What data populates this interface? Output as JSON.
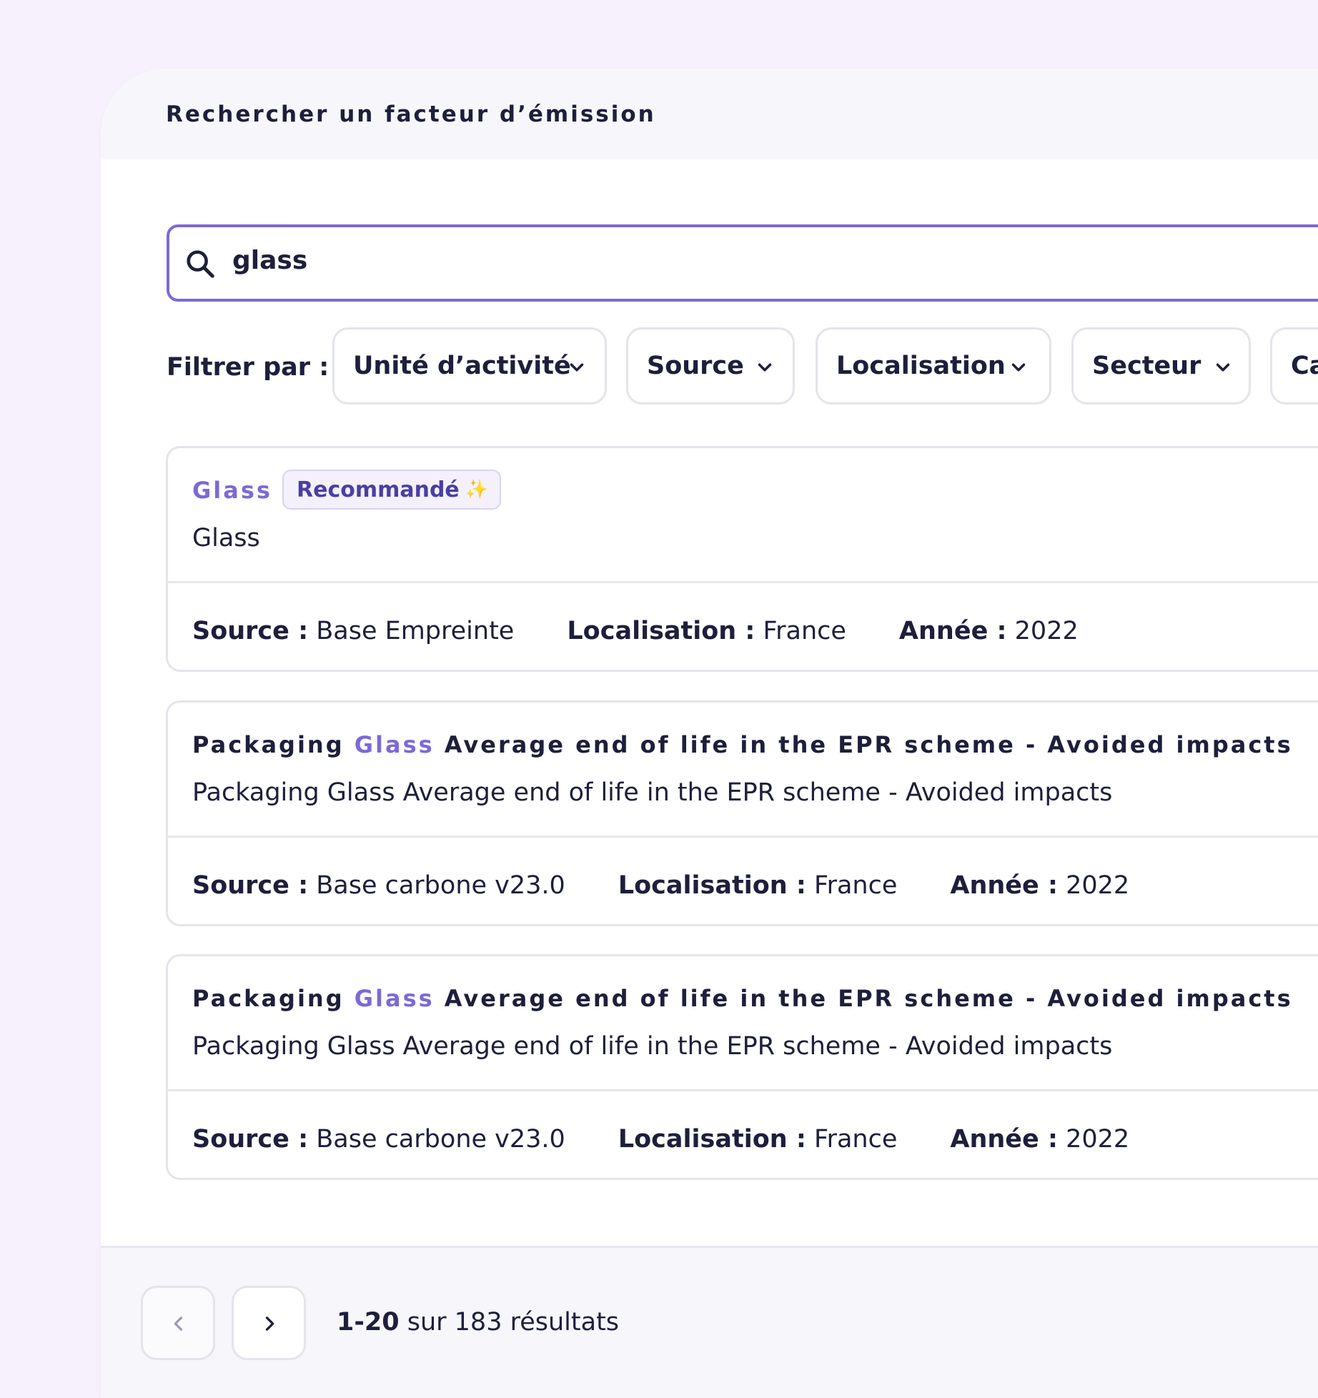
{
  "panel": {
    "title": "Rechercher un facteur d’émission"
  },
  "search": {
    "value": "glass"
  },
  "filters": {
    "label": "Filtrer par :",
    "chips": [
      "Unité d’activité",
      "Source",
      "Localisation",
      "Secteur",
      "Ca"
    ]
  },
  "results": [
    {
      "title_pre": "",
      "title_hl": "Glass",
      "title_post": "",
      "badge": "Recommandé",
      "subtitle": "Glass",
      "source_label": "Source :",
      "source": "Base Empreinte",
      "loc_label": "Localisation :",
      "loc": "France",
      "year_label": "Année :",
      "year": "2022"
    },
    {
      "title_pre": "Packaging ",
      "title_hl": "Glass",
      "title_post": " Average end of life in the EPR scheme - Avoided impacts",
      "subtitle": "Packaging Glass Average end of life in the EPR scheme - Avoided impacts",
      "source_label": "Source :",
      "source": "Base carbone v23.0",
      "loc_label": "Localisation :",
      "loc": "France",
      "year_label": "Année :",
      "year": "2022"
    },
    {
      "title_pre": "Packaging ",
      "title_hl": "Glass",
      "title_post": " Average end of life in the EPR scheme - Avoided impacts",
      "subtitle": "Packaging Glass Average end of life in the EPR scheme - Avoided impacts",
      "source_label": "Source :",
      "source": "Base carbone v23.0",
      "loc_label": "Localisation :",
      "loc": "France",
      "year_label": "Année :",
      "year": "2022"
    }
  ],
  "pagination": {
    "range": "1-20",
    "rest": "sur 183 résultats"
  },
  "colors": {
    "accent": "#7e68d6",
    "text": "#1d1f3b",
    "background": "#f6f1fc"
  },
  "icons": {
    "search": "search-icon",
    "chevron": "chevron-down-icon",
    "prev": "chevron-left-icon",
    "next": "chevron-right-icon",
    "sparkle": "sparkle-icon"
  }
}
